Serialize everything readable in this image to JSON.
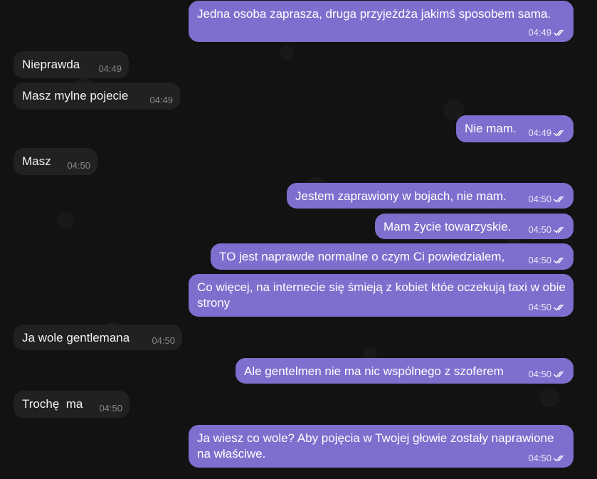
{
  "chat": {
    "messages": [
      {
        "text": "Jedna osoba zaprasza, druga przyjeżdża jakimś sposobem sama.",
        "time": "04:49",
        "direction": "outgoing",
        "read": "read-receipt-icon"
      },
      {
        "text": "Nieprawda",
        "time": "04:49",
        "direction": "incoming"
      },
      {
        "text": "Masz mylne pojecie",
        "time": "04:49",
        "direction": "incoming"
      },
      {
        "text": "Nie mam.",
        "time": "04:49",
        "direction": "outgoing",
        "read": "read-receipt-icon"
      },
      {
        "text": "Masz",
        "time": "04:50",
        "direction": "incoming"
      },
      {
        "text": "Jestem zaprawiony w bojach, nie mam.",
        "time": "04:50",
        "direction": "outgoing",
        "read": "read-receipt-icon"
      },
      {
        "text": "Mam życie towarzyskie.",
        "time": "04:50",
        "direction": "outgoing",
        "read": "read-receipt-icon"
      },
      {
        "text": "TO jest naprawde normalne o czym Ci powiedzialem,",
        "time": "04:50",
        "direction": "outgoing",
        "read": "read-receipt-icon"
      },
      {
        "text": "Co więcej, na internecie się śmieją z kobiet któe oczekują taxi w obie strony",
        "time": "04:50",
        "direction": "outgoing",
        "read": "read-receipt-icon"
      },
      {
        "text": "Ja wole gentlemana",
        "time": "04:50",
        "direction": "incoming"
      },
      {
        "text": "Ale gentelmen nie ma nic wspólnego z szoferem",
        "time": "04:50",
        "direction": "outgoing",
        "read": "read-receipt-icon"
      },
      {
        "text": "Trochę  ma",
        "time": "04:50",
        "direction": "incoming"
      },
      {
        "text": "Ja wiesz co wole? Aby pojęcia w Twojej głowie zostały naprawione na właściwe.",
        "time": "04:50",
        "direction": "outgoing",
        "read": "read-receipt-icon"
      }
    ]
  },
  "colors": {
    "outgoing_bubble": "#7f6ece",
    "incoming_bubble": "#212121",
    "background": "#121212"
  }
}
